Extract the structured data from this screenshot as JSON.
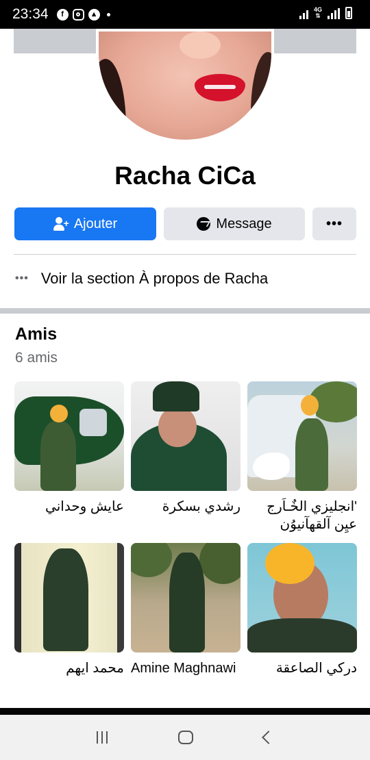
{
  "status_bar": {
    "time": "23:34",
    "network": "4G",
    "icons": [
      "facebook-icon",
      "instagram-icon",
      "app-icon",
      "notification-dot",
      "wifi-signal-icon",
      "cell-signal-icon",
      "battery-icon"
    ]
  },
  "profile": {
    "name": "Racha CiCa"
  },
  "actions": {
    "add_label": "Ajouter",
    "message_label": "Message",
    "more_label": "•••"
  },
  "about": {
    "dots": "•••",
    "label": "Voir la section À propos de Racha"
  },
  "friends": {
    "title": "Amis",
    "count": "6 amis",
    "items": [
      {
        "name": "عايش وحداني"
      },
      {
        "name": "رشدي بسكرة"
      },
      {
        "name": "'انجليزي الخٌـاَرج عيِن آلقهآنيوُن"
      },
      {
        "name": "محمد ايهم"
      },
      {
        "name": "Amine Maghnawi"
      },
      {
        "name": "دركي الصاعقة"
      }
    ]
  },
  "colors": {
    "accent": "#1877f2",
    "button_gray": "#e4e6eb",
    "text": "#050505",
    "secondary_text": "#65676b"
  }
}
